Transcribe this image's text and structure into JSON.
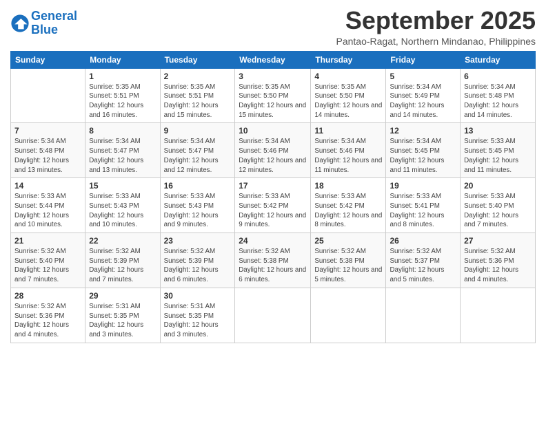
{
  "logo": {
    "text_general": "General",
    "text_blue": "Blue"
  },
  "header": {
    "title": "September 2025",
    "subtitle": "Pantao-Ragat, Northern Mindanao, Philippines"
  },
  "weekdays": [
    "Sunday",
    "Monday",
    "Tuesday",
    "Wednesday",
    "Thursday",
    "Friday",
    "Saturday"
  ],
  "weeks": [
    [
      null,
      {
        "day": "1",
        "sunrise": "Sunrise: 5:35 AM",
        "sunset": "Sunset: 5:51 PM",
        "daylight": "Daylight: 12 hours and 16 minutes."
      },
      {
        "day": "2",
        "sunrise": "Sunrise: 5:35 AM",
        "sunset": "Sunset: 5:51 PM",
        "daylight": "Daylight: 12 hours and 15 minutes."
      },
      {
        "day": "3",
        "sunrise": "Sunrise: 5:35 AM",
        "sunset": "Sunset: 5:50 PM",
        "daylight": "Daylight: 12 hours and 15 minutes."
      },
      {
        "day": "4",
        "sunrise": "Sunrise: 5:35 AM",
        "sunset": "Sunset: 5:50 PM",
        "daylight": "Daylight: 12 hours and 14 minutes."
      },
      {
        "day": "5",
        "sunrise": "Sunrise: 5:34 AM",
        "sunset": "Sunset: 5:49 PM",
        "daylight": "Daylight: 12 hours and 14 minutes."
      },
      {
        "day": "6",
        "sunrise": "Sunrise: 5:34 AM",
        "sunset": "Sunset: 5:48 PM",
        "daylight": "Daylight: 12 hours and 14 minutes."
      }
    ],
    [
      {
        "day": "7",
        "sunrise": "Sunrise: 5:34 AM",
        "sunset": "Sunset: 5:48 PM",
        "daylight": "Daylight: 12 hours and 13 minutes."
      },
      {
        "day": "8",
        "sunrise": "Sunrise: 5:34 AM",
        "sunset": "Sunset: 5:47 PM",
        "daylight": "Daylight: 12 hours and 13 minutes."
      },
      {
        "day": "9",
        "sunrise": "Sunrise: 5:34 AM",
        "sunset": "Sunset: 5:47 PM",
        "daylight": "Daylight: 12 hours and 12 minutes."
      },
      {
        "day": "10",
        "sunrise": "Sunrise: 5:34 AM",
        "sunset": "Sunset: 5:46 PM",
        "daylight": "Daylight: 12 hours and 12 minutes."
      },
      {
        "day": "11",
        "sunrise": "Sunrise: 5:34 AM",
        "sunset": "Sunset: 5:46 PM",
        "daylight": "Daylight: 12 hours and 11 minutes."
      },
      {
        "day": "12",
        "sunrise": "Sunrise: 5:34 AM",
        "sunset": "Sunset: 5:45 PM",
        "daylight": "Daylight: 12 hours and 11 minutes."
      },
      {
        "day": "13",
        "sunrise": "Sunrise: 5:33 AM",
        "sunset": "Sunset: 5:45 PM",
        "daylight": "Daylight: 12 hours and 11 minutes."
      }
    ],
    [
      {
        "day": "14",
        "sunrise": "Sunrise: 5:33 AM",
        "sunset": "Sunset: 5:44 PM",
        "daylight": "Daylight: 12 hours and 10 minutes."
      },
      {
        "day": "15",
        "sunrise": "Sunrise: 5:33 AM",
        "sunset": "Sunset: 5:43 PM",
        "daylight": "Daylight: 12 hours and 10 minutes."
      },
      {
        "day": "16",
        "sunrise": "Sunrise: 5:33 AM",
        "sunset": "Sunset: 5:43 PM",
        "daylight": "Daylight: 12 hours and 9 minutes."
      },
      {
        "day": "17",
        "sunrise": "Sunrise: 5:33 AM",
        "sunset": "Sunset: 5:42 PM",
        "daylight": "Daylight: 12 hours and 9 minutes."
      },
      {
        "day": "18",
        "sunrise": "Sunrise: 5:33 AM",
        "sunset": "Sunset: 5:42 PM",
        "daylight": "Daylight: 12 hours and 8 minutes."
      },
      {
        "day": "19",
        "sunrise": "Sunrise: 5:33 AM",
        "sunset": "Sunset: 5:41 PM",
        "daylight": "Daylight: 12 hours and 8 minutes."
      },
      {
        "day": "20",
        "sunrise": "Sunrise: 5:33 AM",
        "sunset": "Sunset: 5:40 PM",
        "daylight": "Daylight: 12 hours and 7 minutes."
      }
    ],
    [
      {
        "day": "21",
        "sunrise": "Sunrise: 5:32 AM",
        "sunset": "Sunset: 5:40 PM",
        "daylight": "Daylight: 12 hours and 7 minutes."
      },
      {
        "day": "22",
        "sunrise": "Sunrise: 5:32 AM",
        "sunset": "Sunset: 5:39 PM",
        "daylight": "Daylight: 12 hours and 7 minutes."
      },
      {
        "day": "23",
        "sunrise": "Sunrise: 5:32 AM",
        "sunset": "Sunset: 5:39 PM",
        "daylight": "Daylight: 12 hours and 6 minutes."
      },
      {
        "day": "24",
        "sunrise": "Sunrise: 5:32 AM",
        "sunset": "Sunset: 5:38 PM",
        "daylight": "Daylight: 12 hours and 6 minutes."
      },
      {
        "day": "25",
        "sunrise": "Sunrise: 5:32 AM",
        "sunset": "Sunset: 5:38 PM",
        "daylight": "Daylight: 12 hours and 5 minutes."
      },
      {
        "day": "26",
        "sunrise": "Sunrise: 5:32 AM",
        "sunset": "Sunset: 5:37 PM",
        "daylight": "Daylight: 12 hours and 5 minutes."
      },
      {
        "day": "27",
        "sunrise": "Sunrise: 5:32 AM",
        "sunset": "Sunset: 5:36 PM",
        "daylight": "Daylight: 12 hours and 4 minutes."
      }
    ],
    [
      {
        "day": "28",
        "sunrise": "Sunrise: 5:32 AM",
        "sunset": "Sunset: 5:36 PM",
        "daylight": "Daylight: 12 hours and 4 minutes."
      },
      {
        "day": "29",
        "sunrise": "Sunrise: 5:31 AM",
        "sunset": "Sunset: 5:35 PM",
        "daylight": "Daylight: 12 hours and 3 minutes."
      },
      {
        "day": "30",
        "sunrise": "Sunrise: 5:31 AM",
        "sunset": "Sunset: 5:35 PM",
        "daylight": "Daylight: 12 hours and 3 minutes."
      },
      null,
      null,
      null,
      null
    ]
  ]
}
